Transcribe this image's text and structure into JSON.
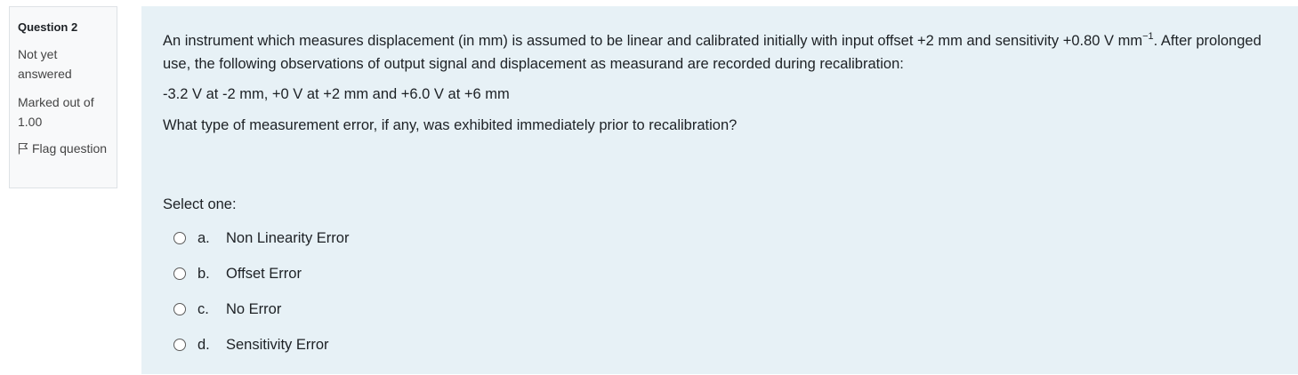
{
  "info": {
    "question_word": "Question",
    "question_number": "2",
    "state": "Not yet answered",
    "grade": "Marked out of 1.00",
    "flag_label": "Flag question"
  },
  "question": {
    "para1_pre": "An instrument which measures displacement (in mm) is assumed to be linear and calibrated initially with input offset +2 mm and sensitivity +0.80 V mm",
    "para1_sup": "−1",
    "para1_post": ". After prolonged use, the following observations of output signal and displacement as measurand are recorded during recalibration:",
    "observations": "-3.2 V at -2 mm, +0 V at +2 mm and +6.0 V at +6 mm",
    "question_text": "What type of measurement error, if any, was exhibited immediately prior to recalibration?"
  },
  "prompt": "Select one:",
  "options": [
    {
      "letter": "a.",
      "label": "Non Linearity Error"
    },
    {
      "letter": "b.",
      "label": "Offset Error"
    },
    {
      "letter": "c.",
      "label": "No Error"
    },
    {
      "letter": "d.",
      "label": "Sensitivity Error"
    }
  ]
}
